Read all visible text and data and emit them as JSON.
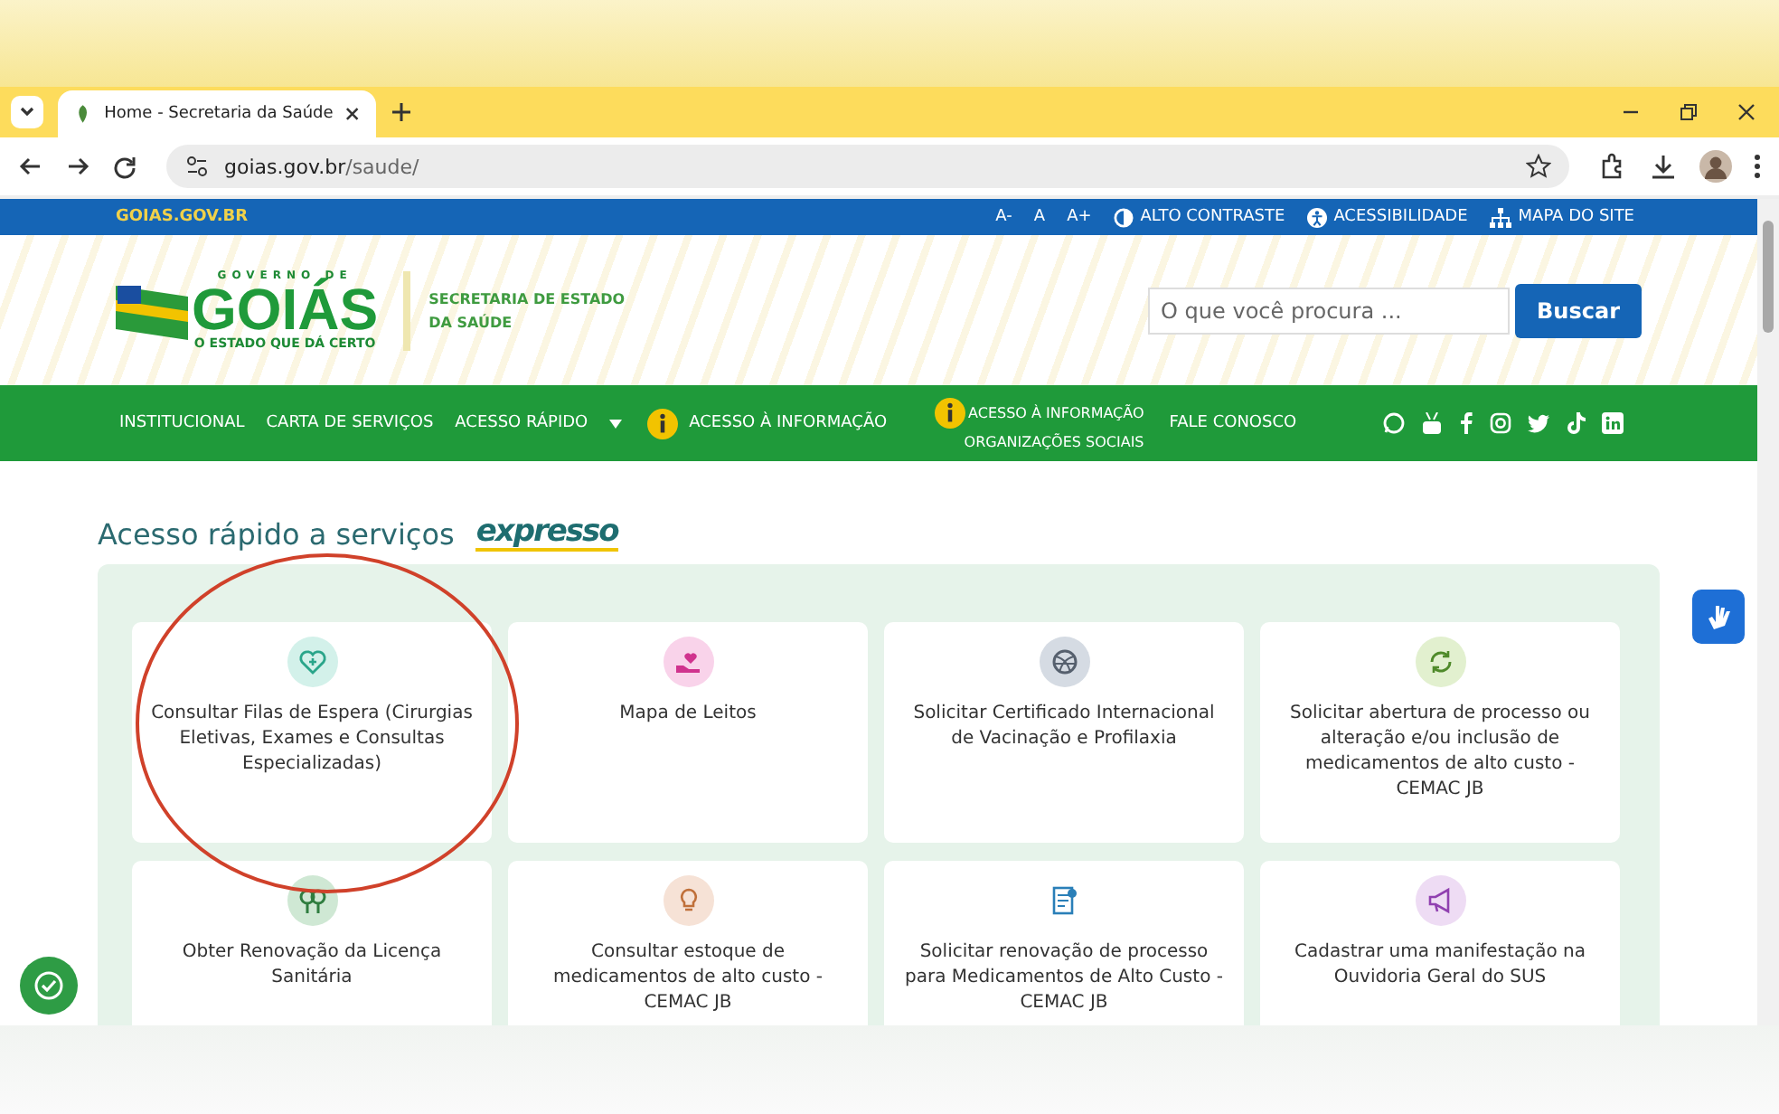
{
  "browser": {
    "tab_title": "Home - Secretaria da Saúde",
    "url_host": "goias.gov.br",
    "url_path": "/saude/"
  },
  "top_bar": {
    "site": "GOIAS.GOV.BR",
    "links": [
      {
        "label": "A-",
        "kind": "text"
      },
      {
        "label": "A",
        "kind": "text"
      },
      {
        "label": "A+",
        "kind": "text"
      },
      {
        "label": "ALTO CONTRASTE",
        "kind": "contrast"
      },
      {
        "label": "ACESSIBILIDADE",
        "kind": "access"
      },
      {
        "label": "MAPA DO SITE",
        "kind": "sitemap"
      }
    ]
  },
  "header": {
    "logo_top": "GOVERNO DE",
    "logo_main": "GOIÁS",
    "logo_slogan": "O ESTADO QUE DÁ CERTO",
    "secretariat": "SECRETARIA DE ESTADO DA SAÚDE",
    "search": {
      "placeholder": "O que você procura ..."
    },
    "search_button": "Buscar"
  },
  "nav": [
    {
      "label": "INSTITUCIONAL",
      "kind": "plain"
    },
    {
      "label": "CARTA DE SERVIÇOS",
      "kind": "plain"
    },
    {
      "label": "ACESSO RÁPIDO",
      "kind": "dropdown"
    },
    {
      "label": "ACESSO À INFORMAÇÃO",
      "kind": "info"
    },
    {
      "label": "ACESSO À INFORMAÇÃO",
      "sublabel": "ORGANIZAÇÕES SOCIAIS",
      "kind": "stacked"
    },
    {
      "label": "FALE CONOSCO",
      "kind": "plain"
    }
  ],
  "section": {
    "title": "Acesso rápido a serviços",
    "badge": "expresso"
  },
  "cards": [
    {
      "label": "Consultar Filas de Espera (Cirurgias Eletivas, Exames e Consultas Especializadas)",
      "color": "#d3f1ea"
    },
    {
      "label": "Mapa de Leitos",
      "color": "#f9d3ea"
    },
    {
      "label": "Solicitar Certificado Internacional de Vacinação e Profilaxia",
      "color": "#d5dbe3"
    },
    {
      "label": "Solicitar abertura de processo ou alteração e/ou inclusão de medicamentos de alto custo - CEMAC JB",
      "color": "#e2f0cf"
    },
    {
      "label": "Obter Renovação da Licença Sanitária",
      "color": "#cfe8d4"
    },
    {
      "label": "Consultar estoque de medicamentos de alto custo - CEMAC JB",
      "color": "#f6e2d6"
    },
    {
      "label": "Solicitar renovação de processo para Medicamentos de Alto Custo - CEMAC JB",
      "color": "#ffffff"
    },
    {
      "label": "Cadastrar uma manifestação na Ouvidoria Geral do SUS",
      "color": "#eedcf4"
    }
  ]
}
